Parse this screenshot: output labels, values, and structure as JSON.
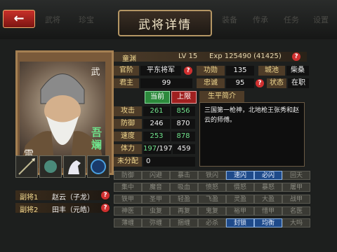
{
  "header": {
    "title": "武将详情",
    "ghost_tabs": [
      "武将",
      "珍宝",
      "装备",
      "传承",
      "任务",
      "设置"
    ]
  },
  "portrait": {
    "tag": "武",
    "name": "吾斓",
    "rank_mark": "雷"
  },
  "info": {
    "name": "童渊",
    "level": "LV 15",
    "exp": "Exp 125490 (41425)",
    "rows": [
      {
        "l1": "官阶",
        "v1": "平东将军",
        "l2": "功勋",
        "v2": "135",
        "l3": "城池",
        "v3": "柴桑"
      },
      {
        "l1": "君主",
        "v1": "99",
        "l2": "忠诚",
        "v2": "95",
        "l3": "状态",
        "v3": "在职"
      }
    ],
    "btn_current": "当前",
    "btn_limit": "上限",
    "bio_title": "生平简介",
    "stats": [
      {
        "label": "攻击",
        "cur": "261",
        "max": "856"
      },
      {
        "label": "防御",
        "cur": "246",
        "max": "870"
      },
      {
        "label": "速度",
        "cur": "253",
        "max": "878"
      }
    ],
    "hp": {
      "label": "体力",
      "cur": "197",
      "sep": "/197",
      "max": "459"
    },
    "unassigned": {
      "label": "未分配",
      "value": "0"
    },
    "bio": "三国第一枪神，北地枪王张秀和赵云的师傅。"
  },
  "lieutenants": [
    {
      "label": "副将1",
      "name": "赵云（子龙）"
    },
    {
      "label": "副将2",
      "name": "田丰（元皓）"
    }
  ],
  "skills": [
    [
      "防御",
      "闪避",
      "暴击",
      "铁闪",
      "速闪",
      "必闪",
      "回天"
    ],
    [
      "集中",
      "魔音",
      "吸血",
      "愤怒",
      "慑怒",
      "暴怒",
      "屠甲"
    ],
    [
      "铁甲",
      "圣甲",
      "轻盈",
      "飞盈",
      "灵盈",
      "大盈",
      "战甲"
    ],
    [
      "神医",
      "虫复",
      "再复",
      "鬼复",
      "裕甲",
      "惜甲",
      "名医"
    ],
    [
      "薄缠",
      "弥缠",
      "捆缠",
      "必杀",
      "封锁",
      "均衡",
      "大吗"
    ]
  ],
  "active_skills": [
    "速闪",
    "必闪",
    "封锁",
    "均衡"
  ]
}
